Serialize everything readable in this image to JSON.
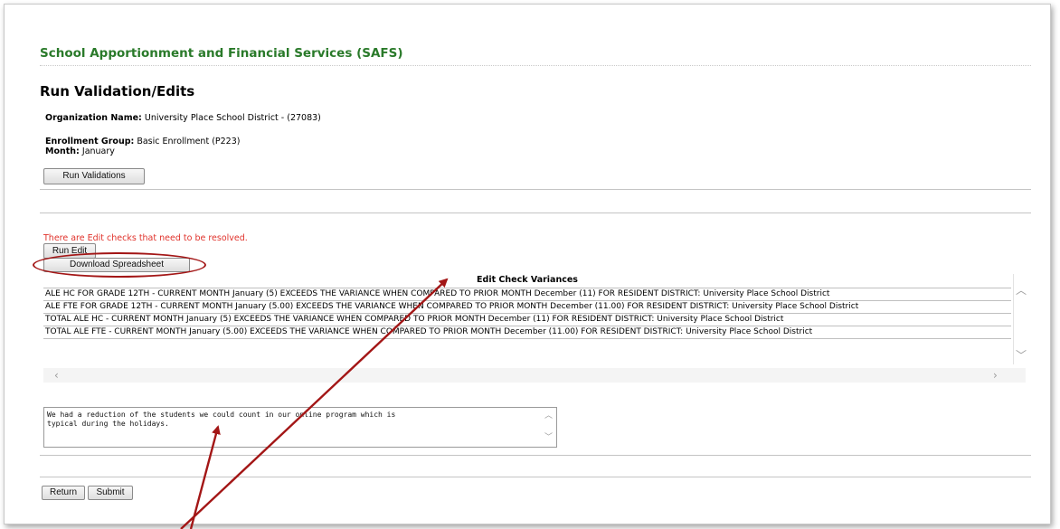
{
  "header": {
    "app_title": "School Apportionment and Financial Services (SAFS)",
    "page_title": "Run Validation/Edits"
  },
  "info": {
    "org_label": "Organization Name:",
    "org_value": "University Place School District - (27083)",
    "group_label": "Enrollment Group:",
    "group_value": "Basic Enrollment (P223)",
    "month_label": "Month:",
    "month_value": "January"
  },
  "buttons": {
    "run_validations": "Run Validations",
    "run_edit": "Run Edit",
    "download": "Download Spreadsheet",
    "return": "Return",
    "submit": "Submit"
  },
  "error_message": "There are Edit checks that need to be resolved.",
  "table": {
    "title": "Edit Check Variances",
    "rows": [
      "ALE HC FOR GRADE 12TH - CURRENT MONTH January (5) EXCEEDS THE VARIANCE WHEN COMPARED TO PRIOR MONTH December (11) FOR RESIDENT DISTRICT: University Place School District",
      "ALE FTE FOR GRADE 12TH - CURRENT MONTH January (5.00) EXCEEDS THE VARIANCE WHEN COMPARED TO PRIOR MONTH December (11.00) FOR RESIDENT DISTRICT: University Place School District",
      "TOTAL ALE HC - CURRENT MONTH January (5) EXCEEDS THE VARIANCE WHEN COMPARED TO PRIOR MONTH December (11) FOR RESIDENT DISTRICT: University Place School District",
      "TOTAL ALE FTE - CURRENT MONTH January (5.00) EXCEEDS THE VARIANCE WHEN COMPARED TO PRIOR MONTH December (11.00) FOR RESIDENT DISTRICT: University Place School District"
    ]
  },
  "comment": {
    "value": "We had a reduction of the students we could count in our online program which is\ntypical during the holidays."
  },
  "colors": {
    "title_green": "#2a7a2a",
    "error_red": "#e0322b",
    "annotation_red": "#a31616"
  }
}
